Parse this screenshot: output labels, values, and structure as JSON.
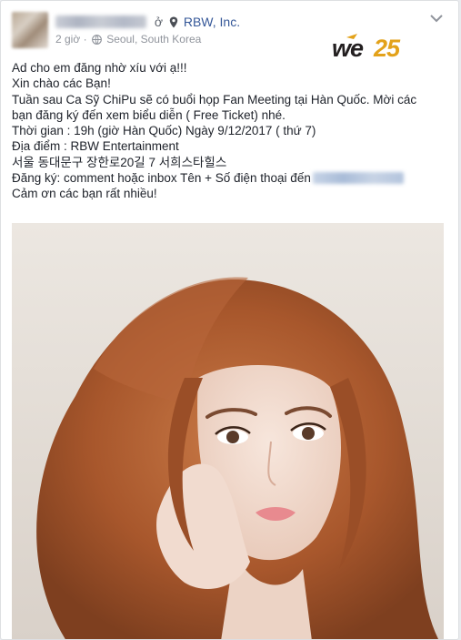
{
  "post": {
    "author": {
      "name_redacted": true
    },
    "separator": "ở",
    "location_page": "RBW, Inc.",
    "time": "2 giờ",
    "location": "Seoul, South Korea",
    "logo_text": "WE25",
    "lines": [
      "Ad cho em đăng nhờ xíu với ạ!!!",
      "Xin chào các Bạn!",
      "Tuần sau Ca Sỹ ChiPu sẽ có buổi họp Fan Meeting tại Hàn Quốc. Mời các",
      "bạn đăng ký đến xem biểu diễn ( Free Ticket) nhé.",
      "Thời gian : 19h (giờ Hàn Quốc) Ngày 9/12/2017 ( thứ 7)",
      "Địa điểm : RBW Entertainment",
      "서울 동대문구 장한로20길 7 서희스타힐스",
      "Đăng ký: comment hoặc inbox Tên + Số điện thoại đến",
      "Cảm ơn các bạn rất nhiều!"
    ]
  },
  "colors": {
    "link": "#365899",
    "meta": "#90949c",
    "text": "#1d2129",
    "logo_accent": "#e3a21a"
  }
}
